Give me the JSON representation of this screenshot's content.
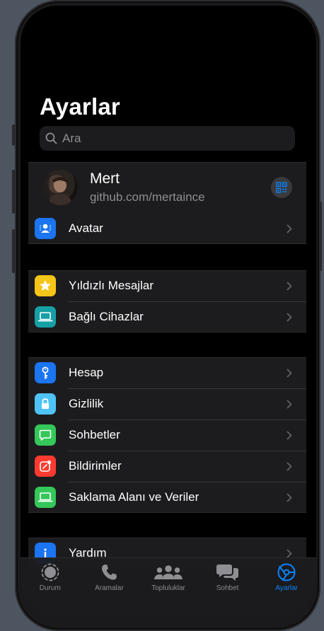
{
  "header": {
    "title": "Ayarlar"
  },
  "search": {
    "placeholder": "Ara"
  },
  "profile": {
    "name": "Mert",
    "subtitle": "github.com/mertaince"
  },
  "groups": [
    [
      {
        "label": "Avatar",
        "icon": "avatar-icon",
        "color": "#1b74f0"
      }
    ],
    [
      {
        "label": "Yıldızlı Mesajlar",
        "icon": "star-icon",
        "color": "#f5c518"
      },
      {
        "label": "Bağlı Cihazlar",
        "icon": "laptop-icon",
        "color": "#16a0a5"
      }
    ],
    [
      {
        "label": "Hesap",
        "icon": "key-icon",
        "color": "#1b74f0"
      },
      {
        "label": "Gizlilik",
        "icon": "lock-icon",
        "color": "#4fc3f7"
      },
      {
        "label": "Sohbetler",
        "icon": "chat-bubble-icon",
        "color": "#34c759"
      },
      {
        "label": "Bildirimler",
        "icon": "notification-icon",
        "color": "#ff3b30"
      },
      {
        "label": "Saklama Alanı ve Veriler",
        "icon": "storage-icon",
        "color": "#34c759"
      }
    ],
    [
      {
        "label": "Yardım",
        "icon": "info-icon",
        "color": "#1b74f0"
      }
    ]
  ],
  "tabbar": {
    "tabs": [
      {
        "label": "Durum",
        "icon": "status-icon",
        "active": false
      },
      {
        "label": "Aramalar",
        "icon": "phone-icon",
        "active": false
      },
      {
        "label": "Topluluklar",
        "icon": "communities-icon",
        "active": false
      },
      {
        "label": "Sohbet",
        "icon": "chats-icon",
        "active": false
      },
      {
        "label": "Ayarlar",
        "icon": "settings-icon",
        "active": true
      }
    ],
    "active_color": "#0a84ff",
    "inactive_color": "#8e8e93"
  }
}
